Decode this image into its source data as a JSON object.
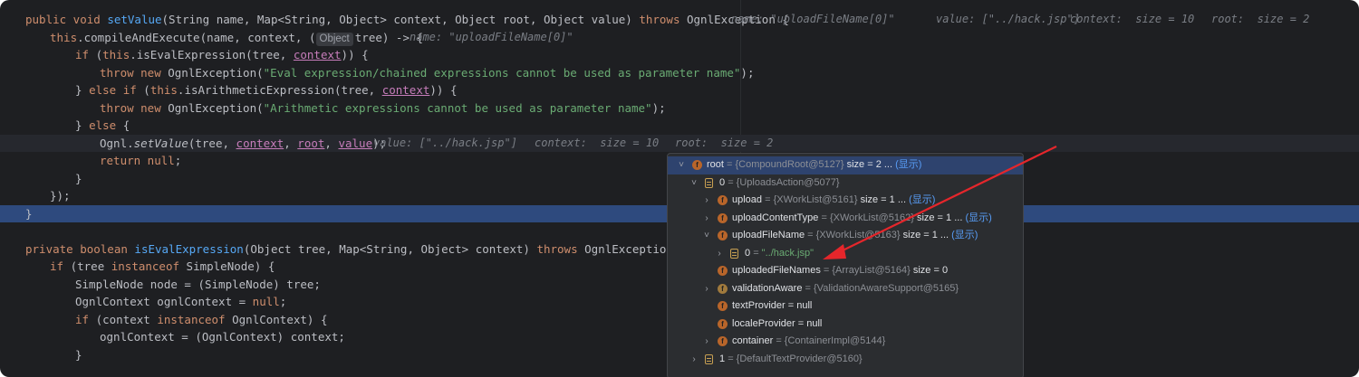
{
  "editor": {
    "lines": [
      {
        "parts": [
          {
            "t": "public void ",
            "c": "kw"
          },
          {
            "t": "setValue",
            "c": "fn"
          },
          {
            "t": "(String name, Map<String, Object> context, Object root, Object value) "
          },
          {
            "t": "throws",
            "c": "kw"
          },
          {
            "t": " OgnlException {"
          }
        ],
        "hint": [
          {
            "t": "name: \"uploadFileName[0]\""
          },
          {
            "t": "value: [\"../hack.jsp\"]"
          },
          {
            "t": "context:  size = 10"
          },
          {
            "t": "root:  size = 2"
          }
        ]
      },
      {
        "parts": [
          {
            "t": "this",
            "c": "kw"
          },
          {
            "t": ".compileAndExecute(name, context, ("
          },
          {
            "t": "Object",
            "c": "chip"
          },
          {
            "t": "tree) -> {"
          }
        ],
        "hint": [
          {
            "t": "name: \"uploadFileName[0]\""
          }
        ]
      },
      {
        "parts": [
          {
            "t": "if",
            "c": "kw"
          },
          {
            "t": " ("
          },
          {
            "t": "this",
            "c": "kw"
          },
          {
            "t": ".isEvalExpression(tree, "
          },
          {
            "t": "context",
            "c": "ul"
          },
          {
            "t": ")) {"
          }
        ]
      },
      {
        "parts": [
          {
            "t": "throw new",
            "c": "kw"
          },
          {
            "t": " OgnlException("
          },
          {
            "t": "\"Eval expression/chained expressions cannot be used as parameter name\"",
            "c": "str"
          },
          {
            "t": ");"
          }
        ]
      },
      {
        "parts": [
          {
            "t": "} "
          },
          {
            "t": "else if",
            "c": "kw"
          },
          {
            "t": " ("
          },
          {
            "t": "this",
            "c": "kw"
          },
          {
            "t": ".isArithmeticExpression(tree, "
          },
          {
            "t": "context",
            "c": "ul"
          },
          {
            "t": ")) {"
          }
        ]
      },
      {
        "parts": [
          {
            "t": "throw new",
            "c": "kw"
          },
          {
            "t": " OgnlException("
          },
          {
            "t": "\"Arithmetic expressions cannot be used as parameter name\"",
            "c": "str"
          },
          {
            "t": ");"
          }
        ]
      },
      {
        "parts": [
          {
            "t": "} "
          },
          {
            "t": "else",
            "c": "kw"
          },
          {
            "t": " {"
          }
        ]
      },
      {
        "parts": [
          {
            "t": "Ognl."
          },
          {
            "t": "setValue",
            "c": "ital"
          },
          {
            "t": "(tree, "
          },
          {
            "t": "context",
            "c": "ul"
          },
          {
            "t": ", "
          },
          {
            "t": "root",
            "c": "ul"
          },
          {
            "t": ", "
          },
          {
            "t": "value",
            "c": "ul"
          },
          {
            "t": ");"
          }
        ],
        "hint": [
          {
            "t": "value: [\"../hack.jsp\"]"
          },
          {
            "t": "context:  size = 10"
          },
          {
            "t": "root:  size = 2"
          }
        ]
      },
      {
        "parts": [
          {
            "t": "return null",
            "c": "kw"
          },
          {
            "t": ";"
          }
        ]
      },
      {
        "parts": [
          {
            "t": "}"
          }
        ]
      },
      {
        "parts": [
          {
            "t": "});"
          }
        ]
      },
      {
        "parts": [
          {
            "t": "}"
          }
        ]
      },
      {
        "parts": []
      },
      {
        "parts": [
          {
            "t": "private boolean ",
            "c": "kw"
          },
          {
            "t": "isEvalExpression",
            "c": "fn"
          },
          {
            "t": "(Object tree, Map<String, Object> context) "
          },
          {
            "t": "throws",
            "c": "kw"
          },
          {
            "t": " OgnlException {"
          }
        ]
      },
      {
        "parts": [
          {
            "t": "if",
            "c": "kw"
          },
          {
            "t": " (tree "
          },
          {
            "t": "instanceof",
            "c": "kw"
          },
          {
            "t": " SimpleNode) {"
          }
        ]
      },
      {
        "parts": [
          {
            "t": "SimpleNode node = (SimpleNode) tree;"
          }
        ]
      },
      {
        "parts": [
          {
            "t": "OgnlContext ognlContext = "
          },
          {
            "t": "null",
            "c": "kw"
          },
          {
            "t": ";"
          }
        ]
      },
      {
        "parts": [
          {
            "t": "if",
            "c": "kw"
          },
          {
            "t": " (context "
          },
          {
            "t": "instanceof",
            "c": "kw"
          },
          {
            "t": " OgnlContext) {"
          }
        ]
      },
      {
        "parts": [
          {
            "t": "ognlContext = (OgnlContext) context;"
          }
        ]
      },
      {
        "parts": [
          {
            "t": "}"
          }
        ]
      }
    ]
  },
  "debug_tree": [
    {
      "arrow": "˅",
      "icon": "field",
      "name": "root",
      "ref": "= {CompoundRoot@5127}",
      "size": "size = 2 ...",
      "link": "(显示)"
    },
    {
      "arrow": "˅",
      "icon": "array",
      "name": "0",
      "ref": "= {UploadsAction@5077}"
    },
    {
      "arrow": "›",
      "icon": "field",
      "name": "upload",
      "ref": "= {XWorkList@5161}",
      "size": "size = 1 ...",
      "link": "(显示)"
    },
    {
      "arrow": "›",
      "icon": "field",
      "name": "uploadContentType",
      "ref": "= {XWorkList@5162}",
      "size": "size = 1 ...",
      "link": "(显示)"
    },
    {
      "arrow": "˅",
      "icon": "field",
      "name": "uploadFileName",
      "ref": "= {XWorkList@5163}",
      "size": "size = 1 ...",
      "link": "(显示)"
    },
    {
      "arrow": "›",
      "icon": "array",
      "name": "0",
      "ref": "= ",
      "str": "\"../hack.jsp\""
    },
    {
      "arrow": "",
      "icon": "field",
      "name": "uploadedFileNames",
      "ref": "= {ArrayList@5164}",
      "size": "size = 0"
    },
    {
      "arrow": "›",
      "icon": "lock",
      "name": "validationAware",
      "ref": "= {ValidationAwareSupport@5165}"
    },
    {
      "arrow": "",
      "icon": "field",
      "name": "textProvider",
      "ref": "",
      "plain": "= null"
    },
    {
      "arrow": "",
      "icon": "field",
      "name": "localeProvider",
      "ref": "",
      "plain": "= null"
    },
    {
      "arrow": "›",
      "icon": "field",
      "name": "container",
      "ref": "= {ContainerImpl@5144}"
    },
    {
      "arrow": "›",
      "icon": "array",
      "name": "1",
      "ref": "= {DefaultTextProvider@5160}"
    }
  ],
  "colors": {
    "background": "#1e1f22",
    "keyword": "#cf8e6d",
    "function": "#56a8f5",
    "string": "#6aab73",
    "selection": "#2e4a7e",
    "annotation_arrow": "#e5262b"
  }
}
